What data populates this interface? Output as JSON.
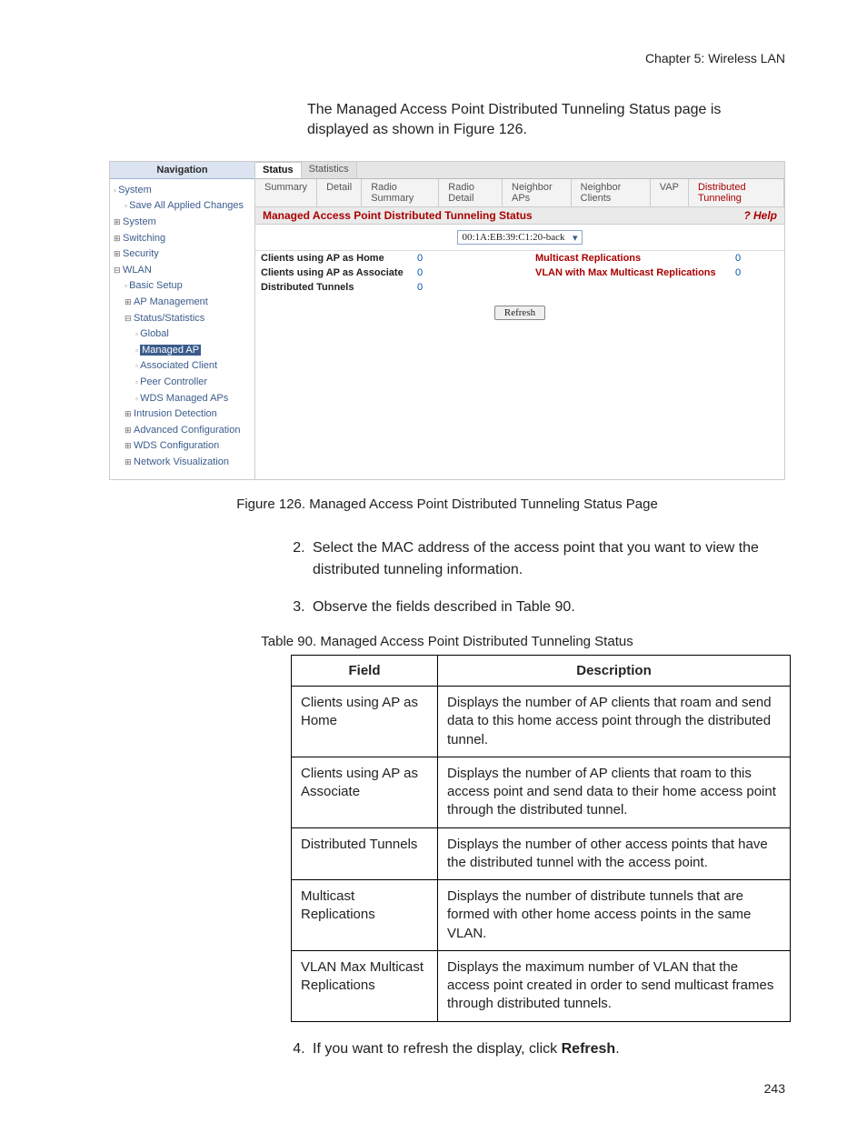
{
  "header": {
    "chapter": "Chapter 5: Wireless LAN"
  },
  "intro": "The Managed Access Point Distributed Tunneling Status page is displayed as shown in Figure 126.",
  "screenshot": {
    "nav_header": "Navigation",
    "nav": {
      "system_root": "System",
      "save": "Save All Applied Changes",
      "system": "System",
      "switching": "Switching",
      "security": "Security",
      "wlan": "WLAN",
      "basic_setup": "Basic Setup",
      "ap_mgmt": "AP Management",
      "status": "Status/Statistics",
      "global": "Global",
      "managed_ap": "Managed AP",
      "assoc_client": "Associated Client",
      "peer_ctrl": "Peer Controller",
      "wds_aps": "WDS Managed APs",
      "intrusion": "Intrusion Detection",
      "adv_cfg": "Advanced Configuration",
      "wds_cfg": "WDS Configuration",
      "net_vis": "Network Visualization"
    },
    "tabs": {
      "status": "Status",
      "statistics": "Statistics"
    },
    "subtabs": {
      "summary": "Summary",
      "detail": "Detail",
      "radio_summary": "Radio Summary",
      "radio_detail": "Radio Detail",
      "neighbor_aps": "Neighbor APs",
      "neighbor_clients": "Neighbor Clients",
      "vap": "VAP",
      "dist_tunnel": "Distributed Tunneling"
    },
    "status_title": "Managed Access Point Distributed Tunneling Status",
    "help": "? Help",
    "mac": "00:1A:EB:39:C1:20-back",
    "rows": {
      "home_lbl": "Clients using AP as Home",
      "home_val": "0",
      "assoc_lbl": "Clients using AP as Associate",
      "assoc_val": "0",
      "dist_lbl": "Distributed Tunnels",
      "dist_val": "0",
      "mrep_lbl": "Multicast Replications",
      "mrep_val": "0",
      "vlan_lbl": "VLAN with Max Multicast Replications",
      "vlan_val": "0"
    },
    "refresh": "Refresh"
  },
  "fig_caption": "Figure 126. Managed Access Point Distributed Tunneling Status Page",
  "steps": {
    "s2": "Select the MAC address of the access point that you want to view the distributed tunneling information.",
    "s3": "Observe the fields described in Table 90.",
    "s4a": "If you want to refresh the display, click ",
    "s4b": "Refresh",
    "s4c": "."
  },
  "table_caption": "Table 90. Managed Access Point Distributed Tunneling Status",
  "table": {
    "h_field": "Field",
    "h_desc": "Description",
    "rows": [
      {
        "f": "Clients using AP as Home",
        "d": "Displays the number of AP clients that roam and send data to this home access point through the distributed tunnel."
      },
      {
        "f": "Clients using AP as Associate",
        "d": "Displays the number of AP clients that roam to this access point and send data to their home access point through the distributed tunnel."
      },
      {
        "f": "Distributed Tunnels",
        "d": "Displays the number of other access points that have the distributed tunnel with the access point."
      },
      {
        "f": "Multicast Replications",
        "d": "Displays the number of distribute tunnels that are formed with other home access points in the same VLAN."
      },
      {
        "f": "VLAN Max Multicast Replications",
        "d": "Displays the maximum number of VLAN that the access point created in order to send multicast frames through distributed tunnels."
      }
    ]
  },
  "page_number": "243"
}
